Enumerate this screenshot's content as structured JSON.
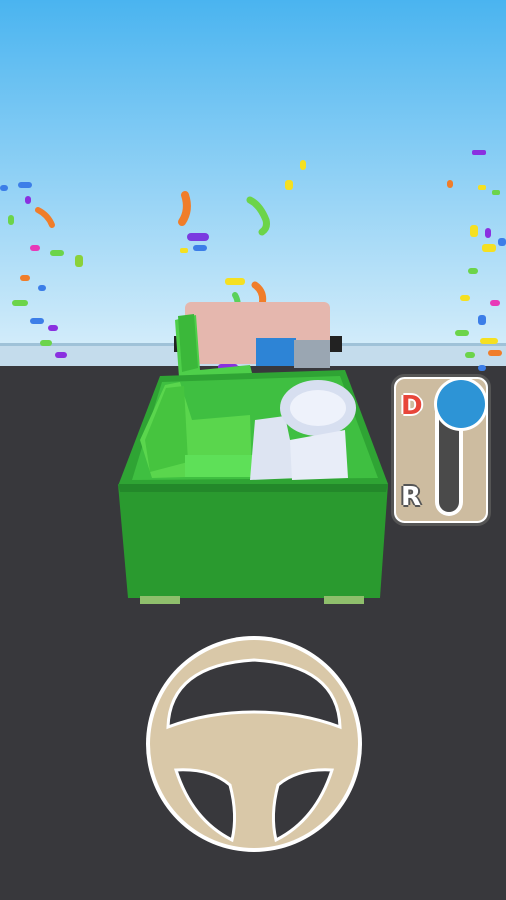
{
  "gear_shifter": {
    "drive_label": "D",
    "reverse_label": "R",
    "selected": "D"
  },
  "colors": {
    "sky_top": "#4ab4f0",
    "sky_bottom": "#d2ecfa",
    "road": "#38383c",
    "truck_green": "#2f9e32",
    "steering_wheel": "#d9c8a8",
    "gear_knob": "#2d94d6"
  }
}
